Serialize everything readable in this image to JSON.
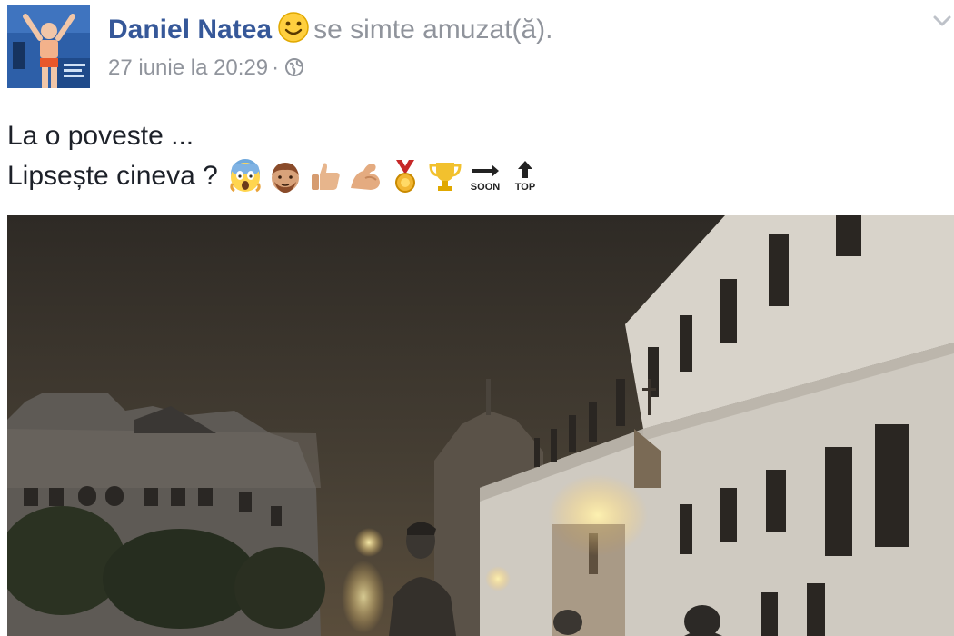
{
  "post": {
    "author": "Daniel Natea",
    "feeling_icon": "slightly-smiling-face-icon",
    "feeling_text": "se simte amuzat(ă).",
    "date": "27 iunie la 20:29",
    "separator": "·",
    "audience_icon": "globe-icon",
    "menu_icon": "chevron-down-icon",
    "text_line1": "La o poveste ...",
    "text_line2": "Lipsește cineva ?",
    "emojis": [
      "face-screaming-icon",
      "man-face-icon",
      "thumbs-up-icon",
      "flexed-biceps-icon",
      "medal-icon",
      "trophy-icon",
      "soon-arrow-icon",
      "top-arrow-icon"
    ],
    "soon_label": "SOON",
    "top_label": "TOP",
    "photo_subject": "night-street-statues-photo"
  },
  "colors": {
    "author": "#365899",
    "meta": "#90949c",
    "text": "#1d2129",
    "sky": "#3b342c"
  }
}
